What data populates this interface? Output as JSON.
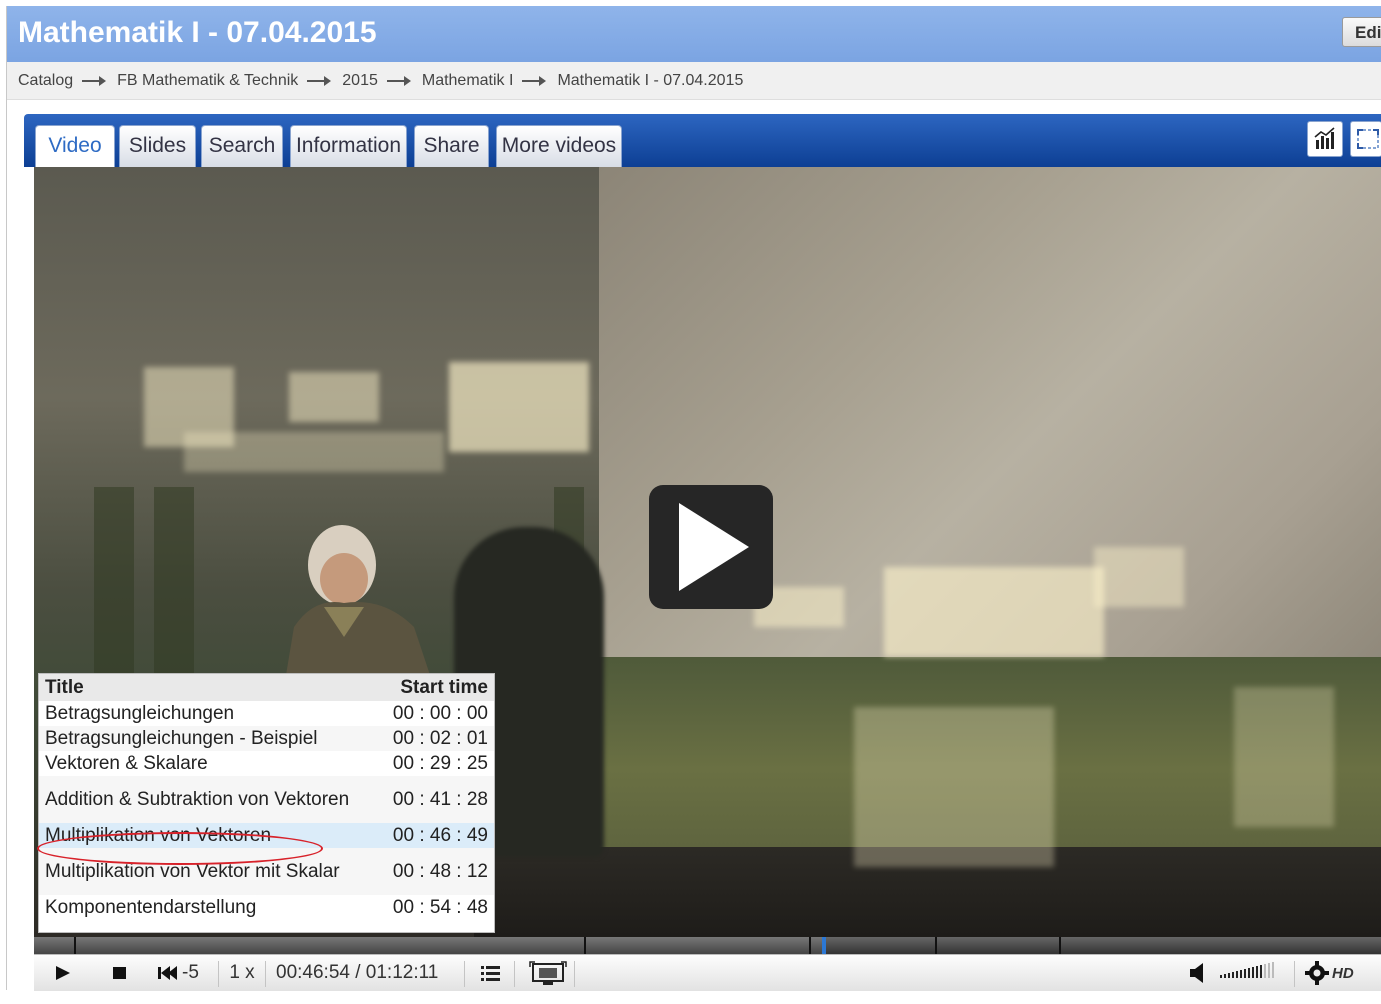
{
  "page": {
    "title": "Mathematik I - 07.04.2015",
    "edit_label": "Edit"
  },
  "breadcrumb": [
    "Catalog",
    "FB Mathematik & Technik",
    "2015",
    "Mathematik I",
    "Mathematik I - 07.04.2015"
  ],
  "tabs": [
    {
      "label": "Video",
      "active": true
    },
    {
      "label": "Slides"
    },
    {
      "label": "Search"
    },
    {
      "label": "Information"
    },
    {
      "label": "Share"
    },
    {
      "label": "More videos"
    }
  ],
  "toolbar_icons": [
    "statistics-icon",
    "fullscreen-icon"
  ],
  "chapters": {
    "header": {
      "title": "Title",
      "start": "Start time"
    },
    "rows": [
      {
        "title": "Betragsungleichungen",
        "time": "00 : 00 : 00"
      },
      {
        "title": "Betragsungleichungen - Beispiel",
        "time": "00 : 02 : 01"
      },
      {
        "title": "Vektoren & Skalare",
        "time": "00 : 29 : 25"
      },
      {
        "title": "Addition & Subtraktion von Vektoren",
        "time": "00 : 41 : 28"
      },
      {
        "title": "Multiplikation von Vektoren",
        "time": "00 : 46 : 49",
        "highlighted": true
      },
      {
        "title": "Multiplikation von Vektor mit Skalar",
        "time": "00 : 48 : 12"
      },
      {
        "title": "Komponentendarstellung",
        "time": "00 : 54 : 48"
      }
    ]
  },
  "controls": {
    "skip_back": "-5",
    "speed": "1 x",
    "time": "00:46:54 / 01:12:11",
    "hd": "HD",
    "current_time": "00:46:54",
    "duration": "01:12:11"
  },
  "colors": {
    "header_bg": "#7ba4e2",
    "tabbar_bg": "#0d3f94",
    "highlight_circle": "#d8222a",
    "active_tab_text": "#2e6bc4"
  }
}
